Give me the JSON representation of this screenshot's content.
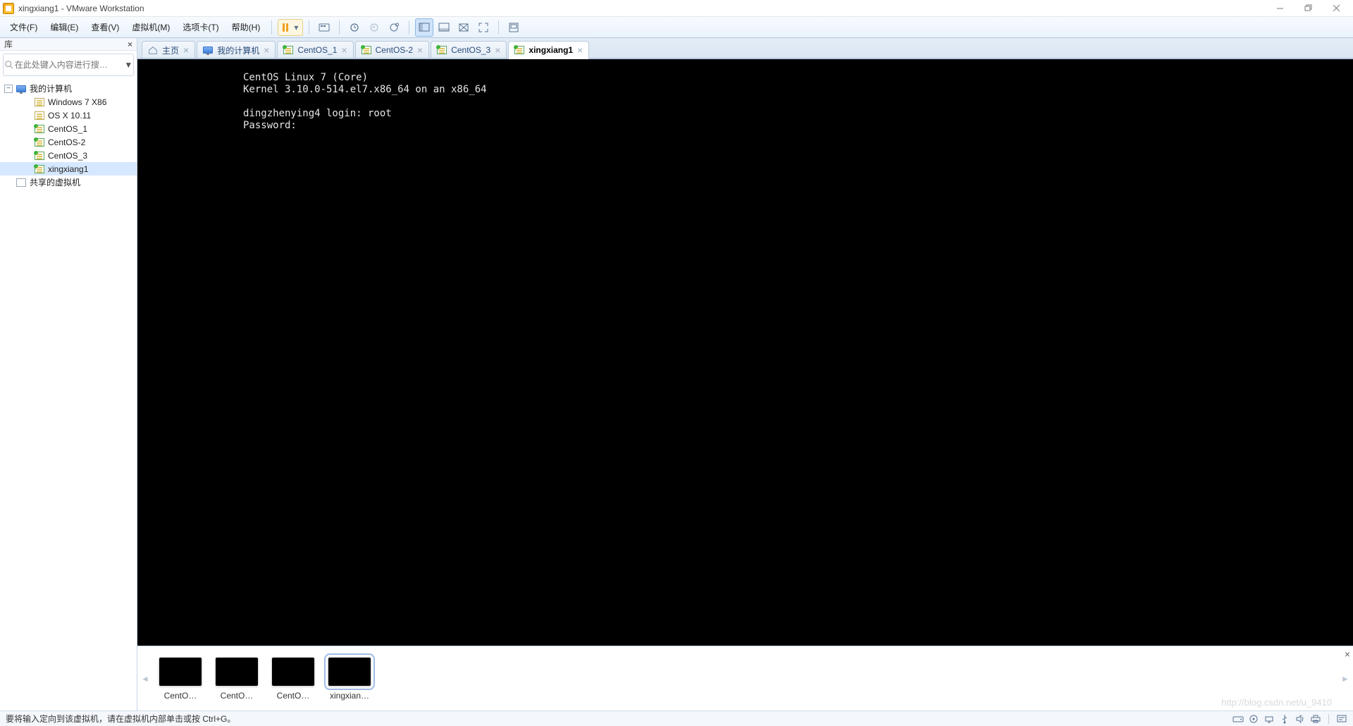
{
  "title": "xingxiang1 - VMware Workstation",
  "window_controls": {
    "min": "minimize",
    "max": "restore",
    "close": "close"
  },
  "menu": [
    "文件(F)",
    "编辑(E)",
    "查看(V)",
    "虚拟机(M)",
    "选项卡(T)",
    "帮助(H)"
  ],
  "library": {
    "title": "库",
    "search_placeholder": "在此处键入内容进行搜…",
    "root": "我的计算机",
    "vms": [
      {
        "name": "Windows 7 X86",
        "running": false
      },
      {
        "name": "OS X 10.11",
        "running": false
      },
      {
        "name": "CentOS_1",
        "running": true
      },
      {
        "name": "CentOS-2",
        "running": true
      },
      {
        "name": "CentOS_3",
        "running": true
      },
      {
        "name": "xingxiang1",
        "running": true,
        "selected": true
      }
    ],
    "shared": "共享的虚拟机"
  },
  "tabs": [
    {
      "label": "主页",
      "type": "home"
    },
    {
      "label": "我的计算机",
      "type": "host"
    },
    {
      "label": "CentOS_1",
      "type": "vm"
    },
    {
      "label": "CentOS-2",
      "type": "vm"
    },
    {
      "label": "CentOS_3",
      "type": "vm"
    },
    {
      "label": "xingxiang1",
      "type": "vm",
      "active": true
    }
  ],
  "console_lines": [
    "CentOS Linux 7 (Core)",
    "Kernel 3.10.0-514.el7.x86_64 on an x86_64",
    "",
    "dingzhenying4 login: root",
    "Password:"
  ],
  "thumbnails": [
    "CentO…",
    "CentO…",
    "CentO…",
    "xingxian…"
  ],
  "thumb_selected": 3,
  "status_text": "要将输入定向到该虚拟机，请在虚拟机内部单击或按 Ctrl+G。",
  "watermark": "http://blog.csdn.net/u_9410"
}
